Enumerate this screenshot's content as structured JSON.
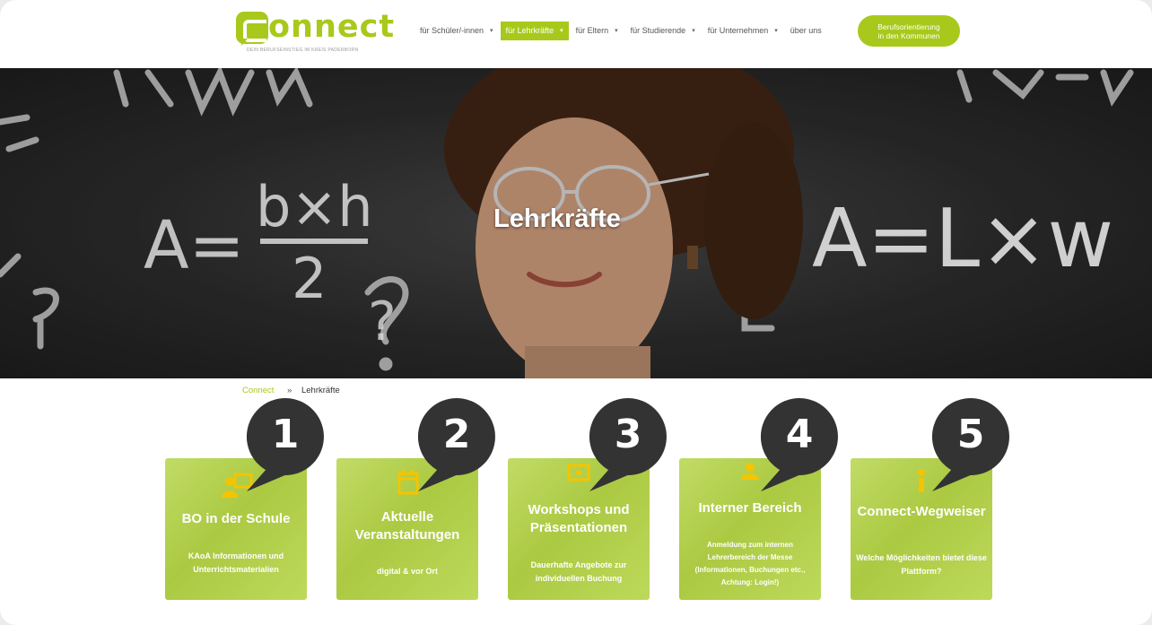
{
  "header": {
    "logo_word": "onnect",
    "logo_tagline": "DEIN BERUFSEINSTIEG IM KREIS PADERBORN",
    "nav": [
      {
        "label": "für Schüler/-innen",
        "caret": "▾",
        "active": false
      },
      {
        "label": "für Lehrkräfte",
        "caret": "▾",
        "active": true
      },
      {
        "label": "für Eltern",
        "caret": "▾",
        "active": false
      },
      {
        "label": "für Studierende",
        "caret": "▾",
        "active": false
      },
      {
        "label": "für Unternehmen",
        "caret": "▾",
        "active": false
      },
      {
        "label": "über uns",
        "caret": "",
        "active": false
      }
    ],
    "cta_line1": "Berufsorientierung",
    "cta_line2": "in den Kommunen"
  },
  "hero": {
    "title": "Lehrkräfte",
    "board_formulas": [
      "A=",
      "b×h",
      "2",
      "A=L×w",
      "?"
    ]
  },
  "breadcrumb": {
    "home": "Connect",
    "separator": "»",
    "current": "Lehrkräfte"
  },
  "cards": [
    {
      "number": "1",
      "icon": "users-icon",
      "title": "BO in der Schule",
      "subtitle": "KAoA Informationen und Unterrichtsmaterialien"
    },
    {
      "number": "2",
      "icon": "calendar-icon",
      "title": "Aktuelle Veranstaltungen",
      "subtitle": "digital & vor Ort"
    },
    {
      "number": "3",
      "icon": "presentation-icon",
      "title": "Workshops und Präsentationen",
      "subtitle": "Dauerhafte Angebote zur individuellen Buchung"
    },
    {
      "number": "4",
      "icon": "users-icon",
      "title": "Interner Bereich",
      "subtitle": "Anmeldung zum internen Lehrerbereich der Messe (Informationen, Buchungen etc., Achtung: Login!)"
    },
    {
      "number": "5",
      "icon": "signpost-icon",
      "title": "Connect-Wegweiser",
      "subtitle": "Welche Möglichkeiten bietet diese Plattform?"
    }
  ],
  "colors": {
    "brand_green": "#a8c91c",
    "card_green": "#b4d445",
    "icon_yellow": "#f5c400",
    "bubble_dark": "#333333"
  }
}
